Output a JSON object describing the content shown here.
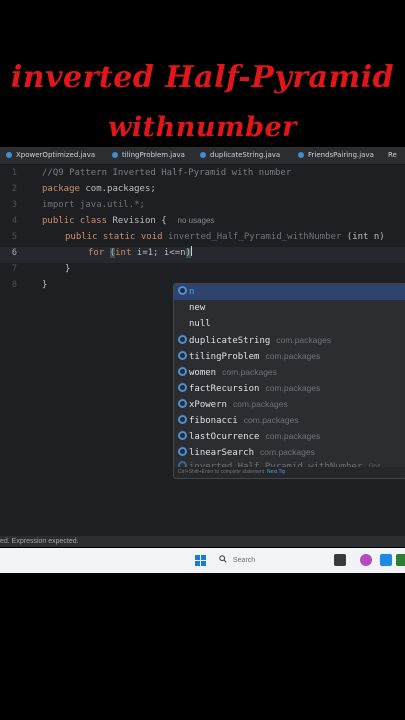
{
  "overlay_title": {
    "line1": "inverted Half-Pyramid",
    "line2": "withnumber"
  },
  "tabs": [
    {
      "label": "XpowerOptimized.java"
    },
    {
      "label": "tilingProblem.java"
    },
    {
      "label": "duplicateString.java"
    },
    {
      "label": "FriendsPairing.java"
    },
    {
      "label": "Re"
    }
  ],
  "line_numbers": [
    "1",
    "2",
    "3",
    "4",
    "5",
    "6",
    "7",
    "8"
  ],
  "code": {
    "l1_comment": "//Q9 Pattern Inverted Half-Pyramid with number",
    "l2_kw": "package",
    "l2_rest": " com.packages;",
    "l3_kw": "import",
    "l3_rest": " java.util.*;",
    "l4_kw": "public class",
    "l4_name": " Revision",
    "l4_brace": " {",
    "l4_hint": "no usages",
    "l5_kw": "public static void",
    "l5_name": " inverted_Half_Pyramid_withNumber",
    "l5_rest": " (int n)",
    "l6_kw": "for",
    "l6_open": "(",
    "l6_type": "int",
    "l6_rest": " i=1; i<=n",
    "l6_close": ")",
    "l7": "}",
    "l8": "}"
  },
  "autocomplete": {
    "items": [
      {
        "label": "n",
        "package": "",
        "selected": true,
        "icon": "variable-icon"
      },
      {
        "label": "new",
        "package": "",
        "selected": false,
        "icon": ""
      },
      {
        "label": "null",
        "package": "",
        "selected": false,
        "icon": ""
      },
      {
        "label": "duplicateString",
        "package": "com.packages",
        "selected": false,
        "icon": "class-icon"
      },
      {
        "label": "tilingProblem",
        "package": "com.packages",
        "selected": false,
        "icon": "class-icon"
      },
      {
        "label": "women",
        "package": "com.packages",
        "selected": false,
        "icon": "class-icon"
      },
      {
        "label": "factRecursion",
        "package": "com.packages",
        "selected": false,
        "icon": "class-icon"
      },
      {
        "label": "xPowern",
        "package": "com.packages",
        "selected": false,
        "icon": "class-icon"
      },
      {
        "label": "fibonacci",
        "package": "com.packages",
        "selected": false,
        "icon": "class-icon"
      },
      {
        "label": "lastOcurrence",
        "package": "com.packages",
        "selected": false,
        "icon": "class-icon"
      },
      {
        "label": "linearSearch",
        "package": "com.packages",
        "selected": false,
        "icon": "class-icon"
      },
      {
        "label": "inverted_Half_Pyramid_withNumber",
        "package": "(int",
        "selected": false,
        "icon": "method-icon"
      }
    ],
    "footer_text": "Ctrl+Shift+Enter to complete statement",
    "footer_tip": "Next Tip"
  },
  "status_text": "ed. Expression expected.",
  "taskbar": {
    "search_placeholder": "Search"
  },
  "colors": {
    "title_red": "#e0161a",
    "editor_bg": "#1e1f22",
    "selection_blue": "#2e436e",
    "keyword_orange": "#cf8e6d",
    "method_blue": "#56a8f5"
  }
}
